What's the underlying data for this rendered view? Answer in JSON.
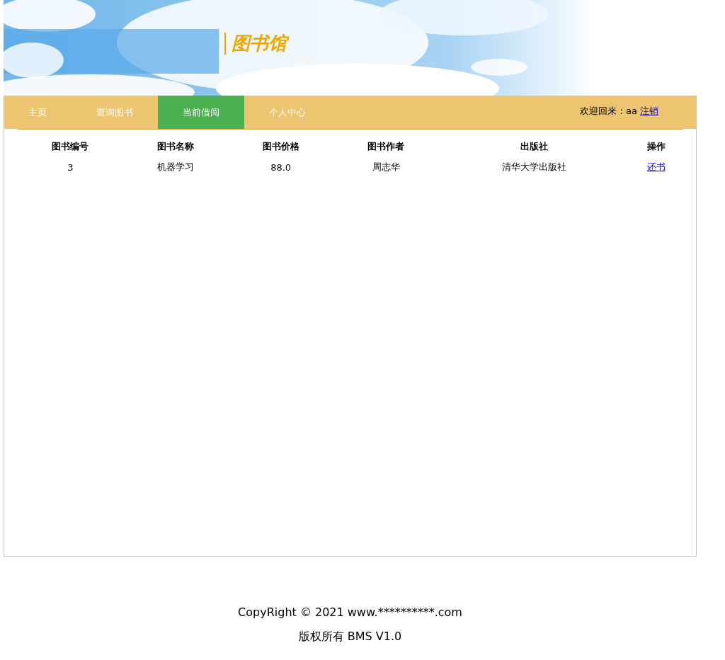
{
  "header": {
    "logo": "图书馆"
  },
  "nav": {
    "tabs": [
      {
        "label": "主页",
        "selected": false
      },
      {
        "label": "查询图书",
        "selected": false
      },
      {
        "label": "当前借阅",
        "selected": true
      },
      {
        "label": "个人中心",
        "selected": false
      }
    ],
    "welcome": "欢迎回来 : aa",
    "logout": "注销"
  },
  "table": {
    "columns": [
      "图书编号",
      "图书名称",
      "图书价格",
      "图书作者",
      "出版社",
      "操作"
    ],
    "rows": [
      {
        "cells": [
          "3",
          "机器学习",
          "88.0",
          "周志华",
          "清华大学出版社"
        ],
        "action": "还书"
      }
    ]
  },
  "footer": {
    "copyright": "CopyRight © 2021 www.**********.com",
    "version": "版权所有 BMS V1.0"
  }
}
